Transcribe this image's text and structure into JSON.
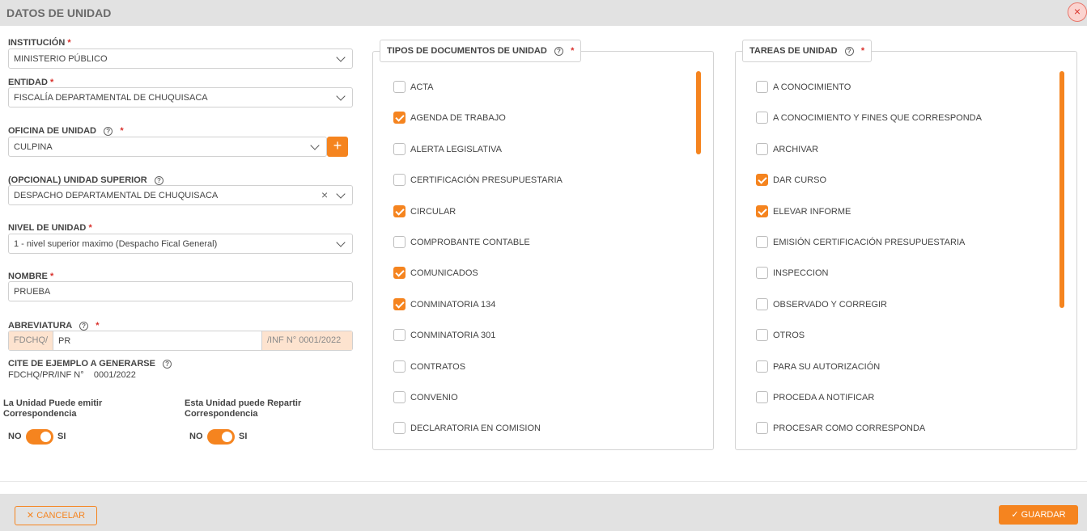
{
  "dialog": {
    "title": "DATOS DE UNIDAD",
    "close_icon": "×"
  },
  "form": {
    "institucion": {
      "label": "INSTITUCIÓN",
      "value": "MINISTERIO PÚBLICO"
    },
    "entidad": {
      "label": "ENTIDAD",
      "value": "FISCALÍA DEPARTAMENTAL DE CHUQUISACA"
    },
    "oficina": {
      "label": "OFICINA DE UNIDAD",
      "value": "CULPINA",
      "add_label": "+"
    },
    "unidad_superior": {
      "label": "(OPCIONAL) UNIDAD SUPERIOR",
      "value": "DESPACHO DEPARTAMENTAL DE CHUQUISACA"
    },
    "nivel": {
      "label": "NIVEL DE UNIDAD",
      "value": "1 - nivel superior maximo (Despacho Fical General)"
    },
    "nombre": {
      "label": "NOMBRE",
      "value": "PRUEBA"
    },
    "abreviatura": {
      "label": "ABREVIATURA",
      "prefix": "FDCHQ/",
      "value": "PR",
      "suffix": "/INF N°   0001/2022"
    },
    "cite": {
      "label": "CITE DE EJEMPLO A GENERARSE",
      "value": "FDCHQ/PR/INF N°    0001/2022"
    },
    "required_mark": "*",
    "help_glyph": "?",
    "toggle_emitir": {
      "label_line1": "La Unidad Puede emitir",
      "label_line2": "Correspondencia",
      "off": "NO",
      "on": "SI",
      "checked": true
    },
    "toggle_repartir": {
      "label_line1": "Esta Unidad puede Repartir",
      "label_line2": "Correspondencia",
      "off": "NO",
      "on": "SI",
      "checked": true
    }
  },
  "tipos_documentos": {
    "title": "TIPOS DE DOCUMENTOS DE UNIDAD",
    "items": [
      {
        "label": "ACTA",
        "checked": false
      },
      {
        "label": "AGENDA DE TRABAJO",
        "checked": true
      },
      {
        "label": "ALERTA LEGISLATIVA",
        "checked": false
      },
      {
        "label": "CERTIFICACIÓN PRESUPUESTARIA",
        "checked": false
      },
      {
        "label": "CIRCULAR",
        "checked": true
      },
      {
        "label": "COMPROBANTE CONTABLE",
        "checked": false
      },
      {
        "label": "COMUNICADOS",
        "checked": true
      },
      {
        "label": "CONMINATORIA 134",
        "checked": true
      },
      {
        "label": "CONMINATORIA 301",
        "checked": false
      },
      {
        "label": "CONTRATOS",
        "checked": false
      },
      {
        "label": "CONVENIO",
        "checked": false
      },
      {
        "label": "DECLARATORIA EN COMISION",
        "checked": false
      }
    ]
  },
  "tareas": {
    "title": "TAREAS DE UNIDAD",
    "items": [
      {
        "label": "A CONOCIMIENTO",
        "checked": false
      },
      {
        "label": "A CONOCIMIENTO Y FINES QUE CORRESPONDA",
        "checked": false
      },
      {
        "label": "ARCHIVAR",
        "checked": false
      },
      {
        "label": "DAR CURSO",
        "checked": true
      },
      {
        "label": "ELEVAR INFORME",
        "checked": true
      },
      {
        "label": "EMISIÓN CERTIFICACIÓN PRESUPUESTARIA",
        "checked": false
      },
      {
        "label": "INSPECCION",
        "checked": false
      },
      {
        "label": "OBSERVADO Y CORREGIR",
        "checked": false
      },
      {
        "label": "OTROS",
        "checked": false
      },
      {
        "label": "PARA SU AUTORIZACIÓN",
        "checked": false
      },
      {
        "label": "PROCEDA A NOTIFICAR",
        "checked": false
      },
      {
        "label": "PROCESAR COMO CORRESPONDA",
        "checked": false
      }
    ]
  },
  "footer": {
    "cancel_label": "CANCELAR",
    "save_label": "GUARDAR"
  },
  "colors": {
    "accent": "#f5841f",
    "required": "#d9302b",
    "header_bg": "#e2e2e2"
  }
}
